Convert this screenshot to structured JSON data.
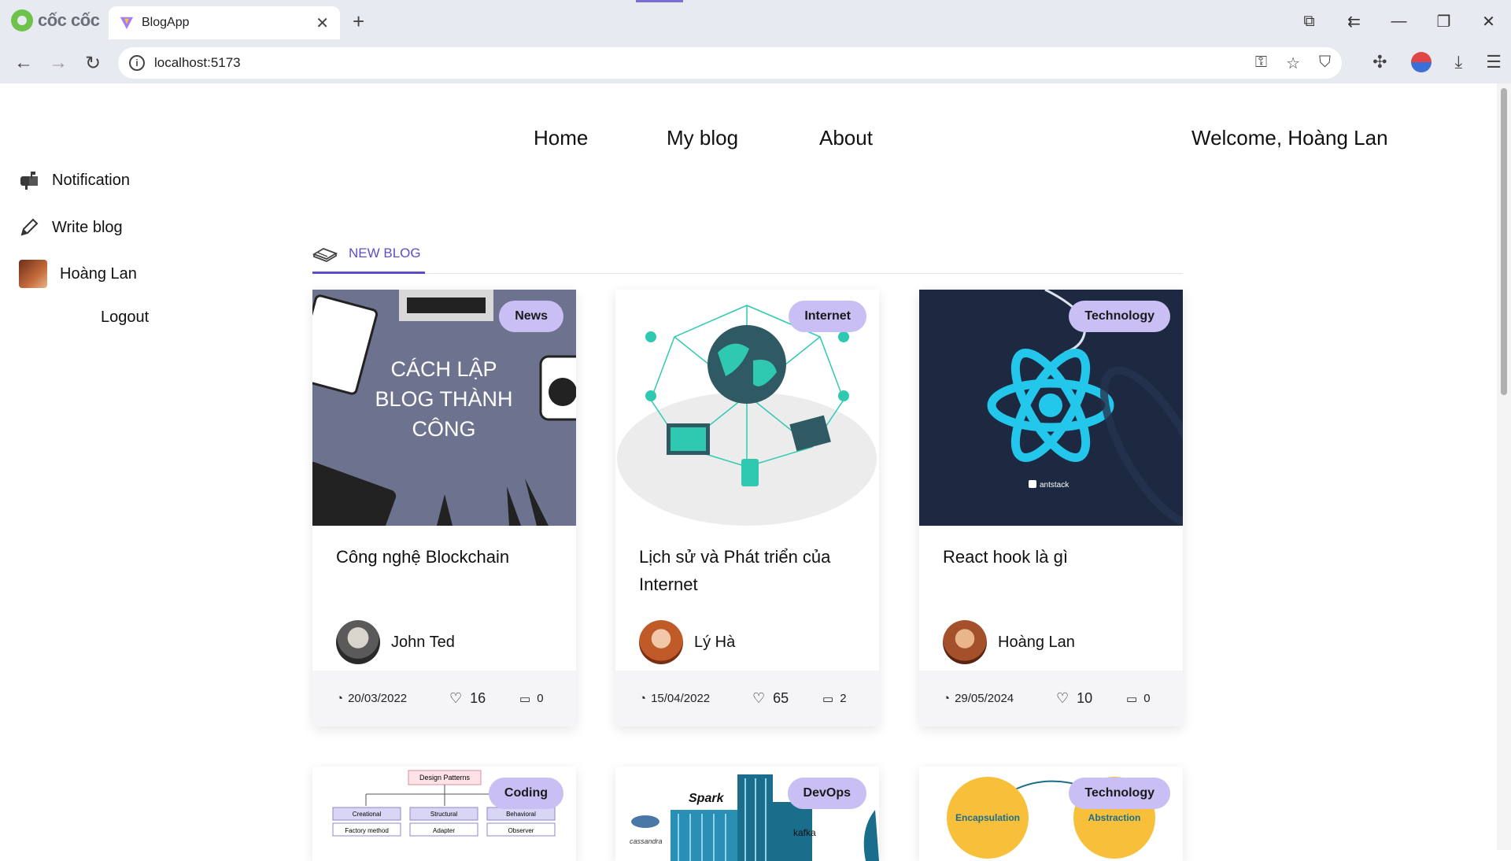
{
  "browser": {
    "brand": "cốc cốc",
    "tab_title": "BlogApp",
    "url": "localhost:5173"
  },
  "nav": {
    "home": "Home",
    "my_blog": "My blog",
    "about": "About",
    "welcome": "Welcome, Hoàng Lan"
  },
  "sidebar": {
    "notification": "Notification",
    "write_blog": "Write blog",
    "user": "Hoàng Lan",
    "logout": "Logout"
  },
  "section": {
    "label": "NEW BLOG"
  },
  "cards": [
    {
      "category": "News",
      "image_text": "CÁCH LẬP BLOG THÀNH CÔNG",
      "title": "Công nghệ Blockchain",
      "author": "John Ted",
      "date": "20/03/2022",
      "likes": "16",
      "comments": "0"
    },
    {
      "category": "Internet",
      "title": "Lịch sử và Phát triển của Internet",
      "author": "Lý Hà",
      "date": "15/04/2022",
      "likes": "65",
      "comments": "2"
    },
    {
      "category": "Technology",
      "image_text": "antstack",
      "title": "React hook là gì",
      "author": "Hoàng Lan",
      "date": "29/05/2024",
      "likes": "10",
      "comments": "0"
    }
  ],
  "cards_row2": [
    {
      "category": "Coding",
      "image_text": [
        "Design Patterns",
        "Creational",
        "Structural",
        "Behavioral",
        "Factory method",
        "Adapter",
        "Observer"
      ]
    },
    {
      "category": "DevOps",
      "image_text": [
        "Spark",
        "kafka",
        "cassandra"
      ]
    },
    {
      "category": "Technology",
      "image_text": [
        "Encapsulation",
        "Abstraction"
      ]
    }
  ],
  "colors": {
    "accent": "#5b4fc9",
    "badge": "#c9bff5",
    "chrome": "#e8eaf1"
  }
}
